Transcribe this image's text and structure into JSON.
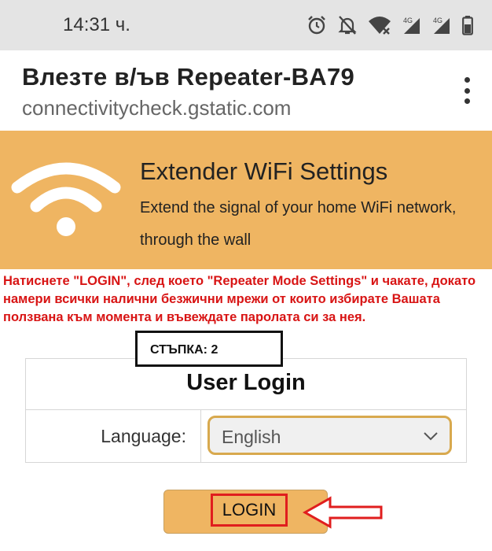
{
  "status_bar": {
    "time": "14:31 ч.",
    "icons": [
      "alarm-icon",
      "notifications-off-icon",
      "wifi-off-icon",
      "4g-signal-icon",
      "4g-signal-icon",
      "battery-icon"
    ],
    "network_label_1": "4G",
    "network_label_2": "4G"
  },
  "portal": {
    "title": "Влезте в/ъв Repeater-BA79",
    "url": "connectivitycheck.gstatic.com",
    "menu_icon": "more-vert-icon"
  },
  "banner": {
    "icon": "wifi-icon",
    "title": "Extender WiFi Settings",
    "subtitle_line1": "Extend the signal of your home WiFi network,",
    "subtitle_line2": "through the wall",
    "color": "#efb562"
  },
  "instruction": "Натиснете \"LOGIN\", след което \"Repeater Mode Settings\" и чакате, докато намери всички налични безжични мрежи от които избирате Вашата ползвана към момента и въвеждате паролата си за нея.",
  "step_label": "СТЪПКА: 2",
  "login_form": {
    "heading": "User Login",
    "language_label": "Language:",
    "language_value": "English",
    "login_button": "LOGIN"
  },
  "colors": {
    "annotation_red": "#e01e1e",
    "instruction_red": "#d81414",
    "select_border": "#d8a94e"
  }
}
